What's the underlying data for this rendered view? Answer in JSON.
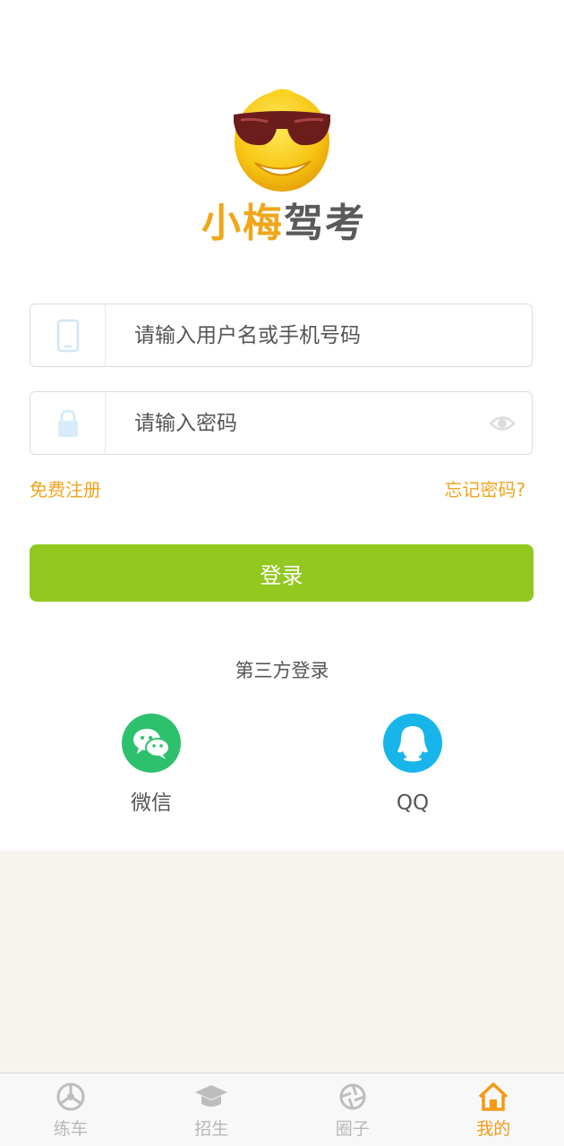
{
  "brand": {
    "name_part1": "小梅",
    "name_part2": "驾考",
    "accent_color": "#f0a71a"
  },
  "login_form": {
    "username_placeholder": "请输入用户名或手机号码",
    "password_placeholder": "请输入密码",
    "username_icon": "phone-icon",
    "password_icon": "lock-icon",
    "password_toggle_icon": "eye-icon"
  },
  "links": {
    "register": "免费注册",
    "forgot_password": "忘记密码?"
  },
  "login_button": {
    "label": "登录",
    "color": "#92c81f"
  },
  "third_party": {
    "title": "第三方登录",
    "options": [
      {
        "label": "微信",
        "icon": "wechat-icon",
        "color": "#2dc16d"
      },
      {
        "label": "QQ",
        "icon": "qq-icon",
        "color": "#18b5ea"
      }
    ]
  },
  "tabbar": {
    "items": [
      {
        "label": "练车",
        "icon": "steering-wheel-icon",
        "active": false
      },
      {
        "label": "招生",
        "icon": "graduation-cap-icon",
        "active": false
      },
      {
        "label": "圈子",
        "icon": "shutter-icon",
        "active": false
      },
      {
        "label": "我的",
        "icon": "home-icon",
        "active": true
      }
    ],
    "active_color": "#f49a14"
  }
}
